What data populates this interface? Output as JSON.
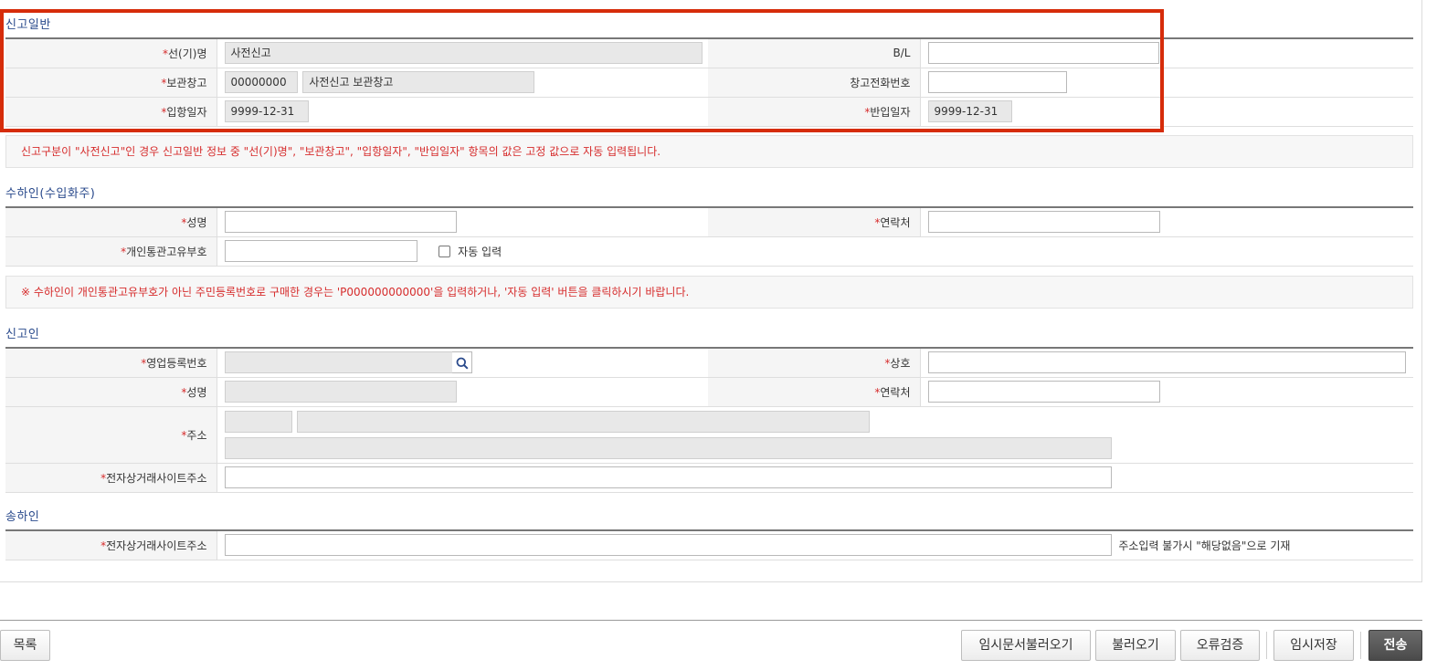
{
  "section_general": {
    "title": "신고일반",
    "ship_name_label": "선(기)명",
    "ship_name_value": "사전신고",
    "bl_label": "B/L",
    "bl_value": "",
    "warehouse_label": "보관창고",
    "warehouse_code": "00000000",
    "warehouse_name": "사전신고 보관창고",
    "warehouse_phone_label": "창고전화번호",
    "warehouse_phone_value": "",
    "arrival_date_label": "입항일자",
    "arrival_date_value": "9999-12-31",
    "carry_in_date_label": "반입일자",
    "carry_in_date_value": "9999-12-31",
    "notice": "신고구분이 \"사전신고\"인 경우 신고일반 정보 중 \"선(기)명\", \"보관창고\", \"입항일자\", \"반입일자\" 항목의 값은 고정 값으로 자동 입력됩니다."
  },
  "section_consignee": {
    "title": "수하인(수입화주)",
    "name_label": "성명",
    "contact_label": "연락처",
    "customs_code_label": "개인통관고유부호",
    "auto_input_label": "자동 입력",
    "notice": "※ 수하인이 개인통관고유부호가 아닌 주민등록번호로 구매한 경우는 'P000000000000'을 입력하거나, '자동 입력' 버튼을 클릭하시기 바랍니다."
  },
  "section_declarant": {
    "title": "신고인",
    "biz_reg_label": "영업등록번호",
    "company_label": "상호",
    "name_label": "성명",
    "contact_label": "연락처",
    "address_label": "주소",
    "ecommerce_label": "전자상거래사이트주소"
  },
  "section_shipper": {
    "title": "송하인",
    "ecommerce_label": "전자상거래사이트주소",
    "ecommerce_hint": "주소입력 불가시 \"해당없음\"으로 기재"
  },
  "required_mark": "*",
  "footer": {
    "list_button": "목록",
    "load_temp_button": "임시문서불러오기",
    "load_button": "불러오기",
    "validate_button": "오류검증",
    "save_temp_button": "임시저장",
    "send_button": "전송"
  },
  "colors": {
    "highlight": "#d62c0a",
    "required": "#d62c2c",
    "section_title": "#2a4a8c"
  },
  "icons": {
    "search": "search-icon"
  }
}
